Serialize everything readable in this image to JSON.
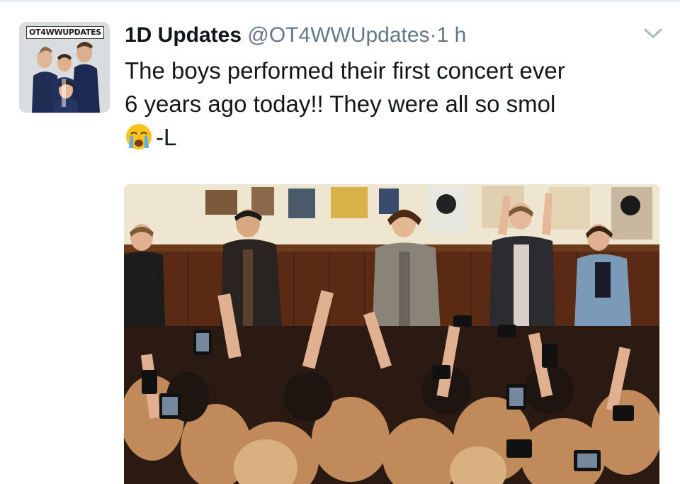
{
  "tweet": {
    "avatar_badge": "OT4WWUPDATES",
    "display_name": "1D Updates",
    "handle": "@OT4WWUpdates",
    "separator": "·",
    "timestamp": "1 h",
    "text_line_1": "The boys performed their first concert ever",
    "text_line_2": "6 years ago today!! They were all so smol",
    "text_line_3": "-L",
    "emoji": "crying-face-emoji",
    "caret_icon": "chevron-down-icon"
  },
  "colors": {
    "name": "#14171a",
    "secondary": "#657786",
    "chevron": "#aab8c2",
    "divider": "#e6ecf0"
  }
}
